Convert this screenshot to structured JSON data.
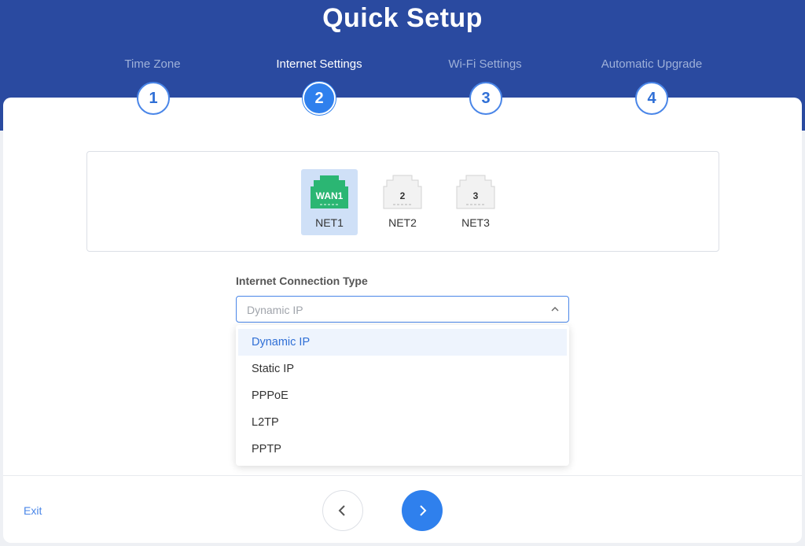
{
  "header": {
    "title": "Quick Setup",
    "steps": [
      {
        "label": "Time Zone",
        "number": "1"
      },
      {
        "label": "Internet Settings",
        "number": "2"
      },
      {
        "label": "Wi-Fi Settings",
        "number": "3"
      },
      {
        "label": "Automatic Upgrade",
        "number": "4"
      }
    ],
    "active_step": 2
  },
  "ports": [
    {
      "jack_label": "WAN1",
      "name": "NET1",
      "selected": true
    },
    {
      "jack_label": "2",
      "name": "NET2",
      "selected": false
    },
    {
      "jack_label": "3",
      "name": "NET3",
      "selected": false
    }
  ],
  "connection": {
    "label": "Internet Connection Type",
    "placeholder": "Dynamic IP",
    "options": [
      "Dynamic IP",
      "Static IP",
      "PPPoE",
      "L2TP",
      "PPTP"
    ],
    "selected": "Dynamic IP"
  },
  "footer": {
    "exit_label": "Exit"
  },
  "colors": {
    "header_bg": "#2a4aa0",
    "accent": "#2f80ed",
    "wan_green": "#2bb673"
  },
  "icons": {
    "prev": "chevron-left-icon",
    "next": "chevron-right-icon",
    "dropdown": "chevron-up-icon"
  }
}
